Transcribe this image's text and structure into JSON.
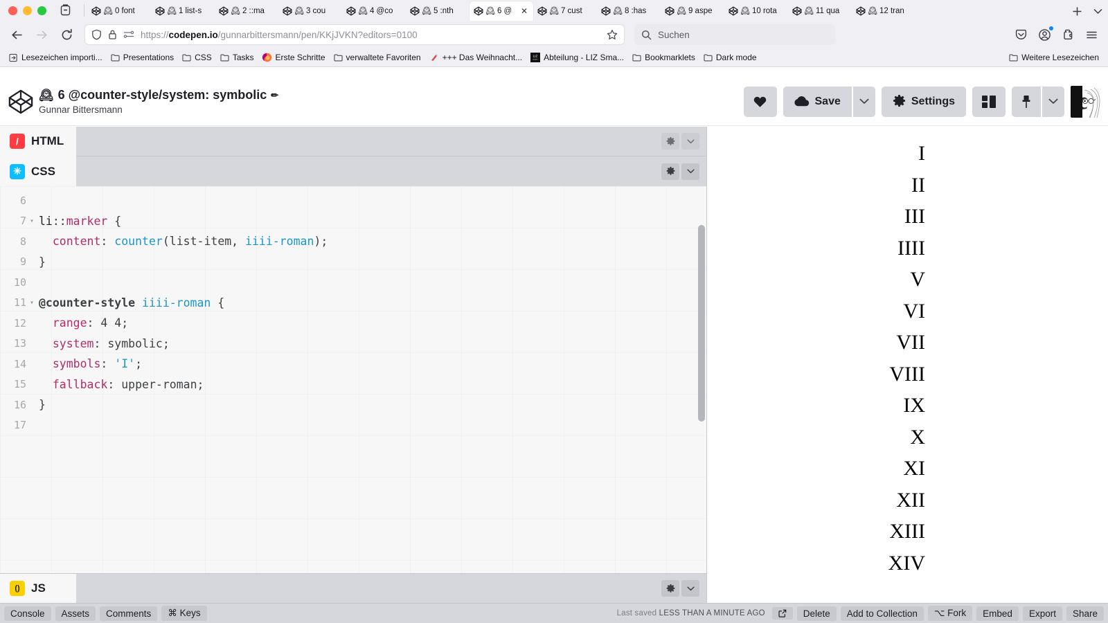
{
  "browser": {
    "window_controls": [
      "close",
      "minimize",
      "zoom"
    ],
    "tab_list_icon": "tab-list-icon",
    "tabs": [
      {
        "title": "0 font",
        "favicon": "codepen-logo-icon",
        "emoji": "🕰",
        "active": false
      },
      {
        "title": "1 list-s",
        "favicon": "codepen-logo-icon",
        "emoji": "🕰",
        "active": false
      },
      {
        "title": "2 ::ma",
        "favicon": "codepen-logo-icon",
        "emoji": "🕰",
        "active": false
      },
      {
        "title": "3 cou",
        "favicon": "codepen-logo-icon",
        "emoji": "🕰",
        "active": false
      },
      {
        "title": "4 @co",
        "favicon": "codepen-logo-icon",
        "emoji": "🕰",
        "active": false
      },
      {
        "title": "5 :nth",
        "favicon": "codepen-logo-icon",
        "emoji": "🕰",
        "active": false
      },
      {
        "title": "6 @",
        "favicon": "codepen-logo-icon",
        "emoji": "🕰",
        "active": true
      },
      {
        "title": "7 cust",
        "favicon": "codepen-logo-icon",
        "emoji": "🕰",
        "active": false
      },
      {
        "title": "8 :has",
        "favicon": "codepen-logo-icon",
        "emoji": "🕰",
        "active": false
      },
      {
        "title": "9 aspe",
        "favicon": "codepen-logo-icon",
        "emoji": "🕰",
        "active": false
      },
      {
        "title": "10 rota",
        "favicon": "codepen-logo-icon",
        "emoji": "🕰",
        "active": false
      },
      {
        "title": "11 qua",
        "favicon": "codepen-logo-icon",
        "emoji": "🕰",
        "active": false
      },
      {
        "title": "12 tran",
        "favicon": "codepen-logo-icon",
        "emoji": "🕰",
        "active": false
      }
    ],
    "new_tab_label": "+",
    "tab_overflow_label": "⌄",
    "nav": {
      "back_icon": "back-arrow-icon",
      "forward_icon": "forward-arrow-icon",
      "reload_icon": "reload-icon"
    },
    "urlbar": {
      "shield_icon": "shield-icon",
      "lock_icon": "lock-icon",
      "permissions_icon": "site-permissions-icon",
      "url_prefix": "https://",
      "url_domain": "codepen.io",
      "url_path": "/gunnarbittersmann/pen/KKjJVKN?editors=0100",
      "bookmark_star_icon": "star-icon"
    },
    "search": {
      "icon": "search-icon",
      "placeholder": "Suchen"
    },
    "toolbar_right": [
      {
        "name": "save-to-pocket-icon"
      },
      {
        "name": "account-icon"
      },
      {
        "name": "extensions-icon"
      },
      {
        "name": "app-menu-icon"
      }
    ],
    "bookmarks": [
      {
        "label": "Lesezeichen importi...",
        "icon": "import-icon"
      },
      {
        "label": "Presentations",
        "icon": "folder-icon"
      },
      {
        "label": "CSS",
        "icon": "folder-icon"
      },
      {
        "label": "Tasks",
        "icon": "folder-icon"
      },
      {
        "label": "Erste Schritte",
        "icon": "firefox-icon"
      },
      {
        "label": "verwaltete Favoriten",
        "icon": "folder-icon"
      },
      {
        "label": "+++ Das Weihnacht...",
        "icon": "bookmark-pin-icon"
      },
      {
        "label": "Abteilung - LIZ Sma...",
        "icon": "liz-icon"
      },
      {
        "label": "Bookmarklets",
        "icon": "folder-icon"
      },
      {
        "label": "Dark mode",
        "icon": "folder-icon"
      }
    ],
    "bookmarks_overflow": {
      "label": "Weitere Lesezeichen",
      "icon": "folder-icon"
    }
  },
  "codepen": {
    "logo_icon": "codepen-logo-icon",
    "pen_emoji": "🕰",
    "pen_title": "6 @counter-style/system: symbolic",
    "edit_title_icon": "pencil-icon",
    "author": "Gunnar Bittersmann",
    "actions": {
      "love_icon": "heart-icon",
      "save_label": "Save",
      "save_icon": "cloud-icon",
      "save_caret_icon": "chevron-down-icon",
      "settings_label": "Settings",
      "settings_icon": "gear-icon",
      "layout_icon": "layout-icon",
      "pin_icon": "pin-icon",
      "pin_caret_icon": "chevron-down-icon",
      "avatar": "user-avatar"
    },
    "panes": [
      {
        "lang": "HTML",
        "badge": "/",
        "badge_color": "#ff3c41",
        "active": false
      },
      {
        "lang": "CSS",
        "badge": "✳",
        "badge_color": "#0ebeff",
        "active": true
      },
      {
        "lang": "JS",
        "badge": "( )",
        "badge_color": "#fcd000",
        "active": false
      }
    ],
    "pane_tools": {
      "settings_icon": "gear-icon",
      "collapse_icon": "chevron-down-icon"
    },
    "code": {
      "language": "CSS",
      "lines": [
        {
          "n": 6,
          "fold": "",
          "tokens": []
        },
        {
          "n": 7,
          "fold": "▾",
          "tokens": [
            {
              "t": "li",
              "c": "tok-sel"
            },
            {
              "t": "::",
              "c": "tok-punct"
            },
            {
              "t": "marker",
              "c": "tok-pseudo"
            },
            {
              "t": " {",
              "c": "tok-punct"
            }
          ]
        },
        {
          "n": 8,
          "fold": "",
          "tokens": [
            {
              "t": "  ",
              "c": "tok-plain"
            },
            {
              "t": "content",
              "c": "tok-prop"
            },
            {
              "t": ": ",
              "c": "tok-punct"
            },
            {
              "t": "counter",
              "c": "tok-fn"
            },
            {
              "t": "(list-item, ",
              "c": "tok-plain"
            },
            {
              "t": "iiii-roman",
              "c": "tok-ident"
            },
            {
              "t": ");",
              "c": "tok-plain"
            }
          ]
        },
        {
          "n": 9,
          "fold": "",
          "tokens": [
            {
              "t": "}",
              "c": "tok-punct"
            }
          ]
        },
        {
          "n": 10,
          "fold": "",
          "tokens": []
        },
        {
          "n": 11,
          "fold": "▾",
          "tokens": [
            {
              "t": "@counter-style",
              "c": "tok-at"
            },
            {
              "t": " ",
              "c": "tok-plain"
            },
            {
              "t": "iiii-roman",
              "c": "tok-ident"
            },
            {
              "t": " {",
              "c": "tok-punct"
            }
          ]
        },
        {
          "n": 12,
          "fold": "",
          "tokens": [
            {
              "t": "  ",
              "c": "tok-plain"
            },
            {
              "t": "range",
              "c": "tok-prop"
            },
            {
              "t": ": 4 4;",
              "c": "tok-plain"
            }
          ]
        },
        {
          "n": 13,
          "fold": "",
          "tokens": [
            {
              "t": "  ",
              "c": "tok-plain"
            },
            {
              "t": "system",
              "c": "tok-prop"
            },
            {
              "t": ": symbolic;",
              "c": "tok-plain"
            }
          ]
        },
        {
          "n": 14,
          "fold": "",
          "tokens": [
            {
              "t": "  ",
              "c": "tok-plain"
            },
            {
              "t": "symbols",
              "c": "tok-prop"
            },
            {
              "t": ": ",
              "c": "tok-plain"
            },
            {
              "t": "'I'",
              "c": "tok-str"
            },
            {
              "t": ";",
              "c": "tok-plain"
            }
          ]
        },
        {
          "n": 15,
          "fold": "",
          "tokens": [
            {
              "t": "  ",
              "c": "tok-plain"
            },
            {
              "t": "fallback",
              "c": "tok-prop"
            },
            {
              "t": ": upper-roman;",
              "c": "tok-plain"
            }
          ]
        },
        {
          "n": 16,
          "fold": "",
          "tokens": [
            {
              "t": "}",
              "c": "tok-punct"
            }
          ]
        },
        {
          "n": 17,
          "fold": "",
          "tokens": []
        }
      ]
    },
    "preview": {
      "markers": [
        "I",
        "II",
        "III",
        "IIII",
        "V",
        "VI",
        "VII",
        "VIII",
        "IX",
        "X",
        "XI",
        "XII",
        "XIII",
        "XIV"
      ]
    },
    "footer": {
      "left_buttons": [
        {
          "label": "Console"
        },
        {
          "label": "Assets"
        },
        {
          "label": "Comments"
        },
        {
          "label": "⌘ Keys"
        }
      ],
      "saved_prefix": "Last saved",
      "saved_time": "LESS THAN A MINUTE AGO",
      "open_icon": "open-external-icon",
      "right_buttons": [
        {
          "label": "Delete"
        },
        {
          "label": "Add to Collection"
        },
        {
          "label": "⌥ Fork"
        },
        {
          "label": "Embed"
        },
        {
          "label": "Export"
        },
        {
          "label": "Share"
        }
      ]
    }
  },
  "colors": {
    "chrome_bg": "#f0f0f4",
    "codepen_gray": "#d5d7dd",
    "editor_bg": "#f7f7f7",
    "html_badge": "#ff3c41",
    "css_badge": "#0ebeff",
    "js_badge": "#fcd000"
  }
}
